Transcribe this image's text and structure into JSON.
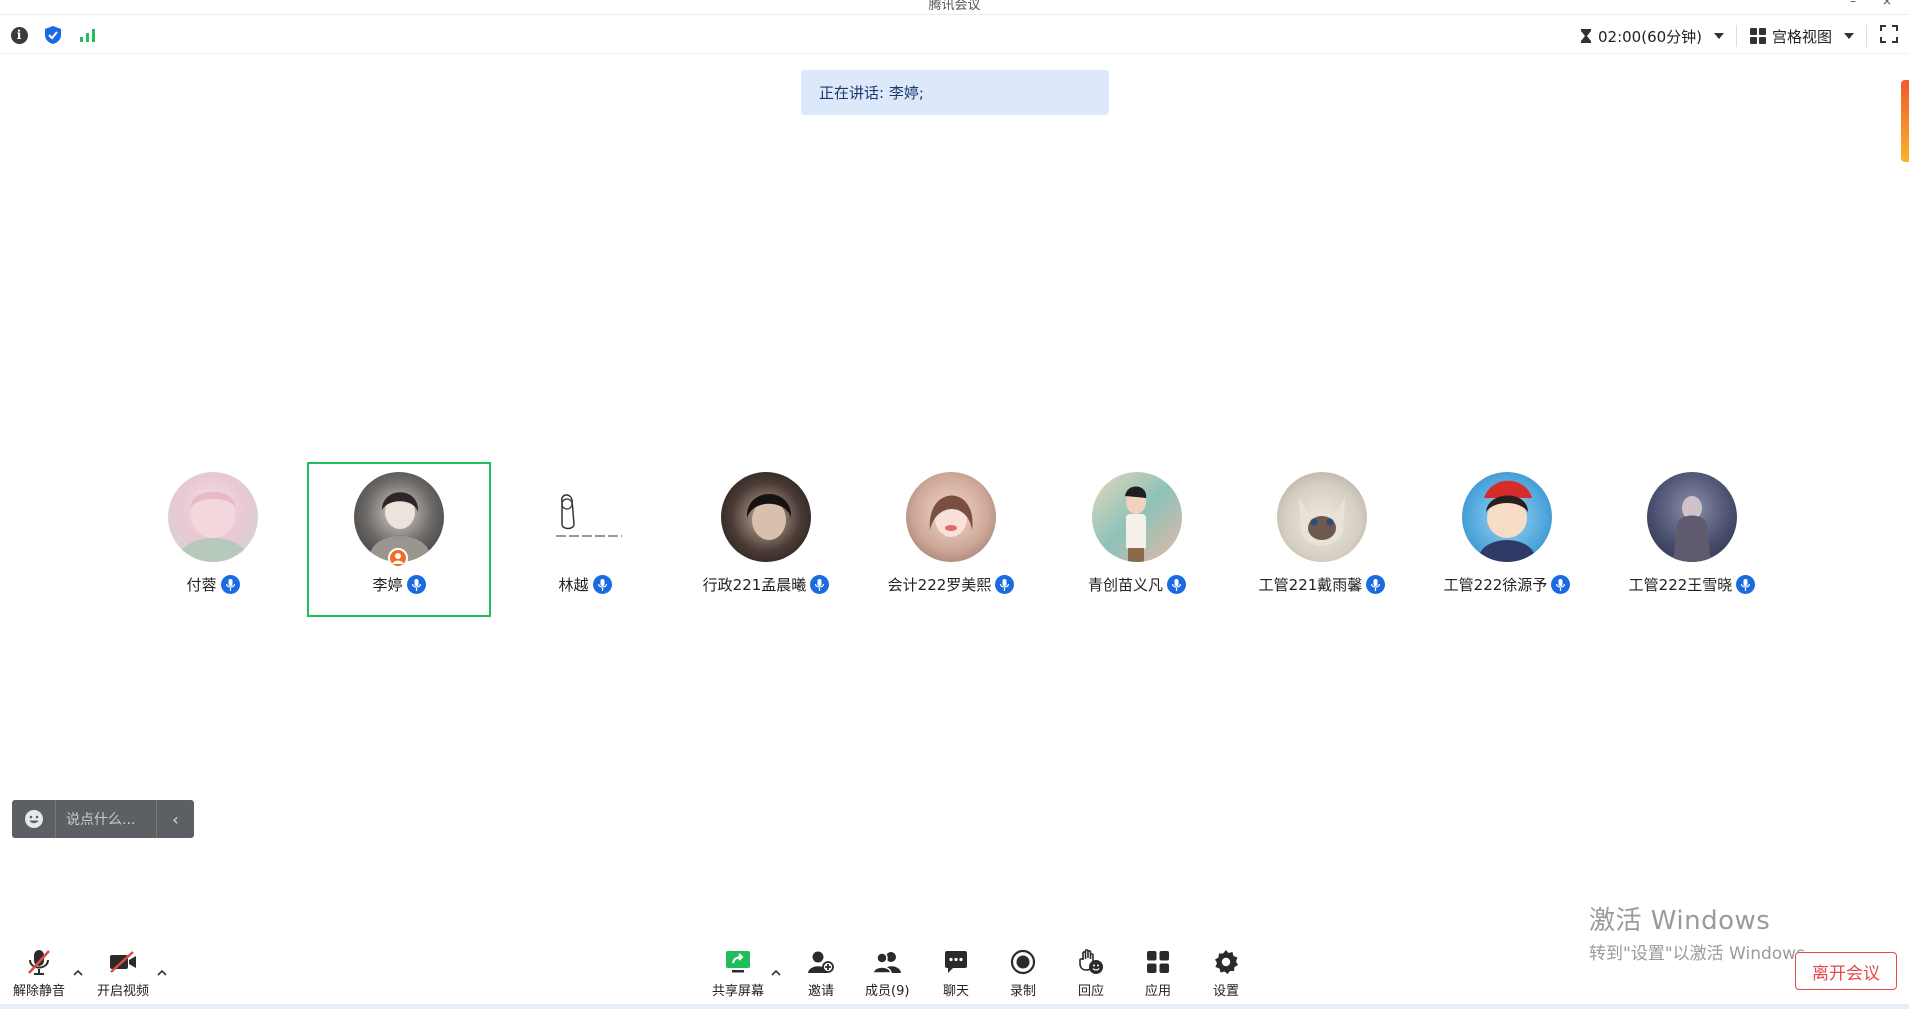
{
  "window": {
    "title": "腾讯会议"
  },
  "topbar": {
    "timer_text": "02:00(60分钟)",
    "view_label": "宫格视图"
  },
  "speaking": {
    "text": "正在讲话: 李婷;"
  },
  "participants": [
    {
      "name": "付蓉"
    },
    {
      "name": "李婷"
    },
    {
      "name": "林越"
    },
    {
      "name": "行政221孟晨曦"
    },
    {
      "name": "会计222罗美熙"
    },
    {
      "name": "青创苗义凡"
    },
    {
      "name": "工管221戴雨馨"
    },
    {
      "name": "工管222徐源予"
    },
    {
      "name": "工管222王雪晓"
    }
  ],
  "chat": {
    "placeholder": "说点什么..."
  },
  "toolbar": {
    "unmute": "解除静音",
    "video": "开启视频",
    "share": "共享屏幕",
    "invite": "邀请",
    "members": "成员(9)",
    "chat": "聊天",
    "record": "录制",
    "react": "回应",
    "apps": "应用",
    "settings": "设置",
    "leave": "离开会议"
  },
  "watermark": {
    "line1": "激活 Windows",
    "line2": "转到\"设置\"以激活 Windows。"
  },
  "colors": {
    "accent_blue": "#1a6be0",
    "active_green": "#1fbe5a",
    "leave_red": "#e24a4a",
    "banner_bg": "#dde9fb"
  }
}
